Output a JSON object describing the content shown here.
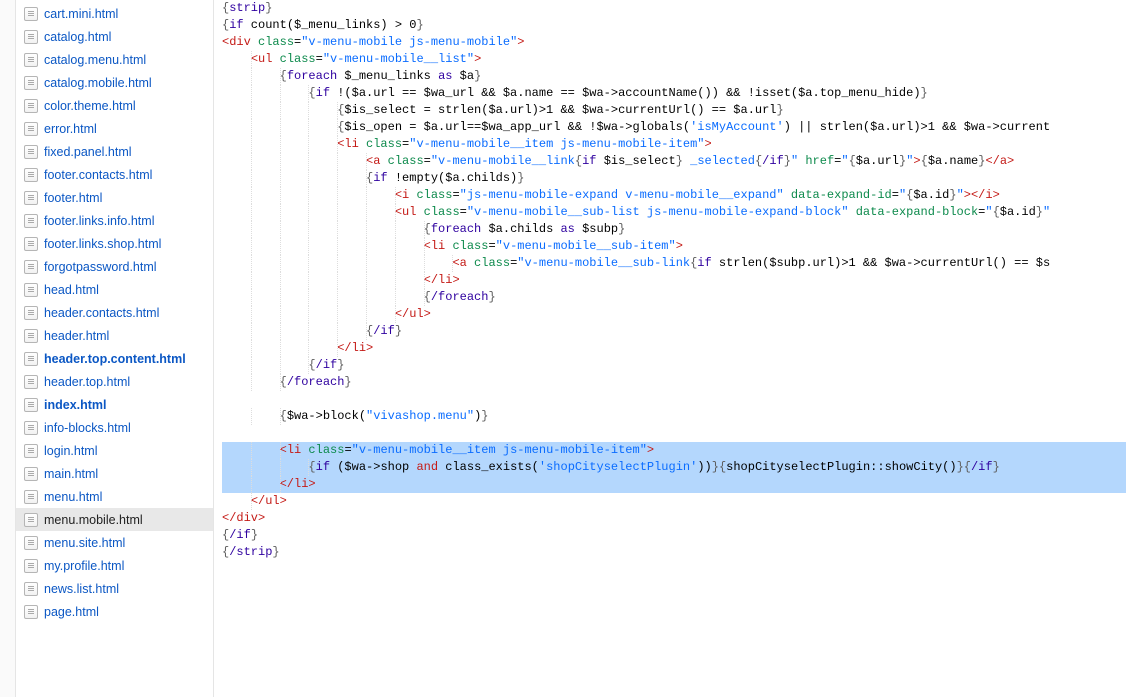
{
  "sidebar": {
    "files": [
      {
        "name": "cart.mini.html",
        "selected": false,
        "bold": false
      },
      {
        "name": "catalog.html",
        "selected": false,
        "bold": false
      },
      {
        "name": "catalog.menu.html",
        "selected": false,
        "bold": false
      },
      {
        "name": "catalog.mobile.html",
        "selected": false,
        "bold": false
      },
      {
        "name": "color.theme.html",
        "selected": false,
        "bold": false
      },
      {
        "name": "error.html",
        "selected": false,
        "bold": false
      },
      {
        "name": "fixed.panel.html",
        "selected": false,
        "bold": false
      },
      {
        "name": "footer.contacts.html",
        "selected": false,
        "bold": false
      },
      {
        "name": "footer.html",
        "selected": false,
        "bold": false
      },
      {
        "name": "footer.links.info.html",
        "selected": false,
        "bold": false
      },
      {
        "name": "footer.links.shop.html",
        "selected": false,
        "bold": false
      },
      {
        "name": "forgotpassword.html",
        "selected": false,
        "bold": false
      },
      {
        "name": "head.html",
        "selected": false,
        "bold": false
      },
      {
        "name": "header.contacts.html",
        "selected": false,
        "bold": false
      },
      {
        "name": "header.html",
        "selected": false,
        "bold": false
      },
      {
        "name": "header.top.content.html",
        "selected": false,
        "bold": true
      },
      {
        "name": "header.top.html",
        "selected": false,
        "bold": false
      },
      {
        "name": "index.html",
        "selected": false,
        "bold": true
      },
      {
        "name": "info-blocks.html",
        "selected": false,
        "bold": false
      },
      {
        "name": "login.html",
        "selected": false,
        "bold": false
      },
      {
        "name": "main.html",
        "selected": false,
        "bold": false
      },
      {
        "name": "menu.html",
        "selected": false,
        "bold": false
      },
      {
        "name": "menu.mobile.html",
        "selected": true,
        "bold": false
      },
      {
        "name": "menu.site.html",
        "selected": false,
        "bold": false
      },
      {
        "name": "my.profile.html",
        "selected": false,
        "bold": false
      },
      {
        "name": "news.list.html",
        "selected": false,
        "bold": false
      },
      {
        "name": "page.html",
        "selected": false,
        "bold": false
      }
    ]
  },
  "code_tokens": [
    [
      {
        "t": "{",
        "c": "k-brace"
      },
      {
        "t": "strip",
        "c": "k-kw"
      },
      {
        "t": "}",
        "c": "k-brace"
      }
    ],
    [
      {
        "t": "{",
        "c": "k-brace"
      },
      {
        "t": "if",
        "c": "k-kw"
      },
      {
        "t": " count($_menu_links) > 0",
        "c": "k-func"
      },
      {
        "t": "}",
        "c": "k-brace"
      }
    ],
    [
      {
        "t": "<",
        "c": "k-tag"
      },
      {
        "t": "div",
        "c": "k-tag"
      },
      {
        "t": " ",
        "c": ""
      },
      {
        "t": "class",
        "c": "k-attr"
      },
      {
        "t": "=",
        "c": ""
      },
      {
        "t": "\"v-menu-mobile js-menu-mobile\"",
        "c": "k-str"
      },
      {
        "t": ">",
        "c": "k-tag"
      }
    ],
    [
      {
        "t": "    ",
        "c": ""
      },
      {
        "t": "<",
        "c": "k-tag"
      },
      {
        "t": "ul",
        "c": "k-tag"
      },
      {
        "t": " ",
        "c": ""
      },
      {
        "t": "class",
        "c": "k-attr"
      },
      {
        "t": "=",
        "c": ""
      },
      {
        "t": "\"v-menu-mobile__list\"",
        "c": "k-str"
      },
      {
        "t": ">",
        "c": "k-tag"
      }
    ],
    [
      {
        "t": "        ",
        "c": ""
      },
      {
        "t": "{",
        "c": "k-brace"
      },
      {
        "t": "foreach",
        "c": "k-kw"
      },
      {
        "t": " $_menu_links ",
        "c": "k-func"
      },
      {
        "t": "as",
        "c": "k-kw"
      },
      {
        "t": " $a",
        "c": "k-func"
      },
      {
        "t": "}",
        "c": "k-brace"
      }
    ],
    [
      {
        "t": "            ",
        "c": ""
      },
      {
        "t": "{",
        "c": "k-brace"
      },
      {
        "t": "if",
        "c": "k-kw"
      },
      {
        "t": " !($a.url == $wa_url && $a.name == $wa->accountName()) && !isset($a.top_menu_hide)",
        "c": "k-func"
      },
      {
        "t": "}",
        "c": "k-brace"
      }
    ],
    [
      {
        "t": "                ",
        "c": ""
      },
      {
        "t": "{",
        "c": "k-brace"
      },
      {
        "t": "$is_select = strlen($a.url)>1 && $wa->currentUrl() == $a.url",
        "c": "k-func"
      },
      {
        "t": "}",
        "c": "k-brace"
      }
    ],
    [
      {
        "t": "                ",
        "c": ""
      },
      {
        "t": "{",
        "c": "k-brace"
      },
      {
        "t": "$is_open = $a.url==$wa_app_url && !$wa->globals(",
        "c": "k-func"
      },
      {
        "t": "'isMyAccount'",
        "c": "k-str"
      },
      {
        "t": ") || strlen($a.url)>1 && $wa->current",
        "c": "k-func"
      }
    ],
    [
      {
        "t": "                ",
        "c": ""
      },
      {
        "t": "<",
        "c": "k-tag"
      },
      {
        "t": "li",
        "c": "k-tag"
      },
      {
        "t": " ",
        "c": ""
      },
      {
        "t": "class",
        "c": "k-attr"
      },
      {
        "t": "=",
        "c": ""
      },
      {
        "t": "\"v-menu-mobile__item js-menu-mobile-item\"",
        "c": "k-str"
      },
      {
        "t": ">",
        "c": "k-tag"
      }
    ],
    [
      {
        "t": "                    ",
        "c": ""
      },
      {
        "t": "<",
        "c": "k-tag"
      },
      {
        "t": "a",
        "c": "k-tag"
      },
      {
        "t": " ",
        "c": ""
      },
      {
        "t": "class",
        "c": "k-attr"
      },
      {
        "t": "=",
        "c": ""
      },
      {
        "t": "\"v-menu-mobile__link",
        "c": "k-str"
      },
      {
        "t": "{",
        "c": "k-brace"
      },
      {
        "t": "if",
        "c": "k-kw"
      },
      {
        "t": " $is_select",
        "c": "k-func"
      },
      {
        "t": "}",
        "c": "k-brace"
      },
      {
        "t": " _selected",
        "c": "k-str"
      },
      {
        "t": "{",
        "c": "k-brace"
      },
      {
        "t": "/if",
        "c": "k-kw"
      },
      {
        "t": "}",
        "c": "k-brace"
      },
      {
        "t": "\"",
        "c": "k-str"
      },
      {
        "t": " ",
        "c": ""
      },
      {
        "t": "href",
        "c": "k-attr"
      },
      {
        "t": "=",
        "c": ""
      },
      {
        "t": "\"",
        "c": "k-str"
      },
      {
        "t": "{",
        "c": "k-brace"
      },
      {
        "t": "$a.url",
        "c": "k-func"
      },
      {
        "t": "}",
        "c": "k-brace"
      },
      {
        "t": "\"",
        "c": "k-str"
      },
      {
        "t": ">",
        "c": "k-tag"
      },
      {
        "t": "{",
        "c": "k-brace"
      },
      {
        "t": "$a.name",
        "c": "k-func"
      },
      {
        "t": "}",
        "c": "k-brace"
      },
      {
        "t": "</",
        "c": "k-tag"
      },
      {
        "t": "a",
        "c": "k-tag"
      },
      {
        "t": ">",
        "c": "k-tag"
      }
    ],
    [
      {
        "t": "                    ",
        "c": ""
      },
      {
        "t": "{",
        "c": "k-brace"
      },
      {
        "t": "if",
        "c": "k-kw"
      },
      {
        "t": " !empty($a.childs)",
        "c": "k-func"
      },
      {
        "t": "}",
        "c": "k-brace"
      }
    ],
    [
      {
        "t": "                        ",
        "c": ""
      },
      {
        "t": "<",
        "c": "k-tag"
      },
      {
        "t": "i",
        "c": "k-tag"
      },
      {
        "t": " ",
        "c": ""
      },
      {
        "t": "class",
        "c": "k-attr"
      },
      {
        "t": "=",
        "c": ""
      },
      {
        "t": "\"js-menu-mobile-expand v-menu-mobile__expand\"",
        "c": "k-str"
      },
      {
        "t": " ",
        "c": ""
      },
      {
        "t": "data-expand-id",
        "c": "k-attr"
      },
      {
        "t": "=",
        "c": ""
      },
      {
        "t": "\"",
        "c": "k-str"
      },
      {
        "t": "{",
        "c": "k-brace"
      },
      {
        "t": "$a.id",
        "c": "k-func"
      },
      {
        "t": "}",
        "c": "k-brace"
      },
      {
        "t": "\"",
        "c": "k-str"
      },
      {
        "t": "></",
        "c": "k-tag"
      },
      {
        "t": "i",
        "c": "k-tag"
      },
      {
        "t": ">",
        "c": "k-tag"
      }
    ],
    [
      {
        "t": "                        ",
        "c": ""
      },
      {
        "t": "<",
        "c": "k-tag"
      },
      {
        "t": "ul",
        "c": "k-tag"
      },
      {
        "t": " ",
        "c": ""
      },
      {
        "t": "class",
        "c": "k-attr"
      },
      {
        "t": "=",
        "c": ""
      },
      {
        "t": "\"v-menu-mobile__sub-list js-menu-mobile-expand-block\"",
        "c": "k-str"
      },
      {
        "t": " ",
        "c": ""
      },
      {
        "t": "data-expand-block",
        "c": "k-attr"
      },
      {
        "t": "=",
        "c": ""
      },
      {
        "t": "\"",
        "c": "k-str"
      },
      {
        "t": "{",
        "c": "k-brace"
      },
      {
        "t": "$a.id",
        "c": "k-func"
      },
      {
        "t": "}",
        "c": "k-brace"
      },
      {
        "t": "\"",
        "c": "k-str"
      }
    ],
    [
      {
        "t": "                            ",
        "c": ""
      },
      {
        "t": "{",
        "c": "k-brace"
      },
      {
        "t": "foreach",
        "c": "k-kw"
      },
      {
        "t": " $a.childs ",
        "c": "k-func"
      },
      {
        "t": "as",
        "c": "k-kw"
      },
      {
        "t": " $subp",
        "c": "k-func"
      },
      {
        "t": "}",
        "c": "k-brace"
      }
    ],
    [
      {
        "t": "                            ",
        "c": ""
      },
      {
        "t": "<",
        "c": "k-tag"
      },
      {
        "t": "li",
        "c": "k-tag"
      },
      {
        "t": " ",
        "c": ""
      },
      {
        "t": "class",
        "c": "k-attr"
      },
      {
        "t": "=",
        "c": ""
      },
      {
        "t": "\"v-menu-mobile__sub-item\"",
        "c": "k-str"
      },
      {
        "t": ">",
        "c": "k-tag"
      }
    ],
    [
      {
        "t": "                                ",
        "c": ""
      },
      {
        "t": "<",
        "c": "k-tag"
      },
      {
        "t": "a",
        "c": "k-tag"
      },
      {
        "t": " ",
        "c": ""
      },
      {
        "t": "class",
        "c": "k-attr"
      },
      {
        "t": "=",
        "c": ""
      },
      {
        "t": "\"v-menu-mobile__sub-link",
        "c": "k-str"
      },
      {
        "t": "{",
        "c": "k-brace"
      },
      {
        "t": "if",
        "c": "k-kw"
      },
      {
        "t": " strlen($subp.url)>1 && $wa->currentUrl() == $s",
        "c": "k-func"
      }
    ],
    [
      {
        "t": "                            ",
        "c": ""
      },
      {
        "t": "</",
        "c": "k-tag"
      },
      {
        "t": "li",
        "c": "k-tag"
      },
      {
        "t": ">",
        "c": "k-tag"
      }
    ],
    [
      {
        "t": "                            ",
        "c": ""
      },
      {
        "t": "{",
        "c": "k-brace"
      },
      {
        "t": "/foreach",
        "c": "k-kw"
      },
      {
        "t": "}",
        "c": "k-brace"
      }
    ],
    [
      {
        "t": "                        ",
        "c": ""
      },
      {
        "t": "</",
        "c": "k-tag"
      },
      {
        "t": "ul",
        "c": "k-tag"
      },
      {
        "t": ">",
        "c": "k-tag"
      }
    ],
    [
      {
        "t": "                    ",
        "c": ""
      },
      {
        "t": "{",
        "c": "k-brace"
      },
      {
        "t": "/if",
        "c": "k-kw"
      },
      {
        "t": "}",
        "c": "k-brace"
      }
    ],
    [
      {
        "t": "                ",
        "c": ""
      },
      {
        "t": "</",
        "c": "k-tag"
      },
      {
        "t": "li",
        "c": "k-tag"
      },
      {
        "t": ">",
        "c": "k-tag"
      }
    ],
    [
      {
        "t": "            ",
        "c": ""
      },
      {
        "t": "{",
        "c": "k-brace"
      },
      {
        "t": "/if",
        "c": "k-kw"
      },
      {
        "t": "}",
        "c": "k-brace"
      }
    ],
    [
      {
        "t": "        ",
        "c": ""
      },
      {
        "t": "{",
        "c": "k-brace"
      },
      {
        "t": "/foreach",
        "c": "k-kw"
      },
      {
        "t": "}",
        "c": "k-brace"
      }
    ],
    [],
    [
      {
        "t": "        ",
        "c": ""
      },
      {
        "t": "{",
        "c": "k-brace"
      },
      {
        "t": "$wa->block(",
        "c": "k-func"
      },
      {
        "t": "\"vivashop.menu\"",
        "c": "k-str"
      },
      {
        "t": ")",
        "c": "k-func"
      },
      {
        "t": "}",
        "c": "k-brace"
      }
    ],
    [],
    [
      {
        "t": "        ",
        "c": ""
      },
      {
        "t": "<",
        "c": "k-tag"
      },
      {
        "t": "li",
        "c": "k-tag"
      },
      {
        "t": " ",
        "c": ""
      },
      {
        "t": "class",
        "c": "k-attr"
      },
      {
        "t": "=",
        "c": ""
      },
      {
        "t": "\"v-menu-mobile__item js-menu-mobile-item\"",
        "c": "k-str"
      },
      {
        "t": ">",
        "c": "k-tag"
      }
    ],
    [
      {
        "t": "            ",
        "c": ""
      },
      {
        "t": "{",
        "c": "k-brace"
      },
      {
        "t": "if",
        "c": "k-kw"
      },
      {
        "t": " ($wa->shop ",
        "c": "k-func"
      },
      {
        "t": "and",
        "c": "k-bool"
      },
      {
        "t": " class_exists(",
        "c": "k-func"
      },
      {
        "t": "'shopCityselectPlugin'",
        "c": "k-str"
      },
      {
        "t": "))",
        "c": "k-func"
      },
      {
        "t": "}",
        "c": "k-brace"
      },
      {
        "t": "{",
        "c": "k-brace"
      },
      {
        "t": "shopCityselectPlugin::showCity()",
        "c": "k-func"
      },
      {
        "t": "}",
        "c": "k-brace"
      },
      {
        "t": "{",
        "c": "k-brace"
      },
      {
        "t": "/if",
        "c": "k-kw"
      },
      {
        "t": "}",
        "c": "k-brace"
      }
    ],
    [
      {
        "t": "        ",
        "c": ""
      },
      {
        "t": "</",
        "c": "k-tag"
      },
      {
        "t": "li",
        "c": "k-tag"
      },
      {
        "t": ">",
        "c": "k-tag"
      }
    ],
    [
      {
        "t": "    ",
        "c": ""
      },
      {
        "t": "</",
        "c": "k-tag"
      },
      {
        "t": "ul",
        "c": "k-tag"
      },
      {
        "t": ">",
        "c": "k-tag"
      }
    ],
    [
      {
        "t": "</",
        "c": "k-tag"
      },
      {
        "t": "div",
        "c": "k-tag"
      },
      {
        "t": ">",
        "c": "k-tag"
      }
    ],
    [
      {
        "t": "{",
        "c": "k-brace"
      },
      {
        "t": "/if",
        "c": "k-kw"
      },
      {
        "t": "}",
        "c": "k-brace"
      }
    ],
    [
      {
        "t": "{",
        "c": "k-brace"
      },
      {
        "t": "/strip",
        "c": "k-kw"
      },
      {
        "t": "}",
        "c": "k-brace"
      }
    ]
  ],
  "highlighted_lines": [
    26,
    27,
    28
  ]
}
